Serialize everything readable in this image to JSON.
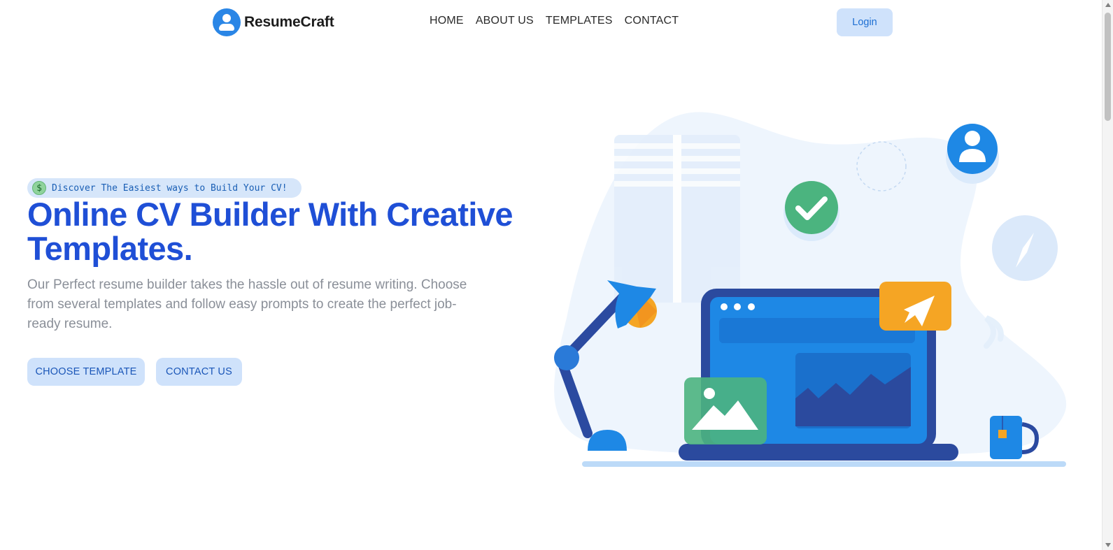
{
  "nav": {
    "brand": "ResumeCraft",
    "brand_icon": "user-avatar-icon",
    "items": [
      "HOME",
      "ABOUT US",
      "TEMPLATES",
      "CONTACT"
    ],
    "login_label": "Login"
  },
  "hero": {
    "badge_icon": "dollar-icon",
    "badge_symbol": "$",
    "badge_text": "Discover The Easiest ways to Build Your CV!",
    "title": "Online CV Builder With Creative Templates.",
    "description": "Our Perfect resume builder takes the hassle out of resume writing. Choose from several templates and follow easy prompts to create the perfect job-ready resume.",
    "primary_button": "CHOOSE TEMPLATE",
    "secondary_button": "CONTACT US"
  },
  "colors": {
    "accent": "#1f4fd6",
    "button_bg": "#cfe2fb",
    "brand_blue": "#2a86e6",
    "text_muted": "#8a8f98"
  }
}
